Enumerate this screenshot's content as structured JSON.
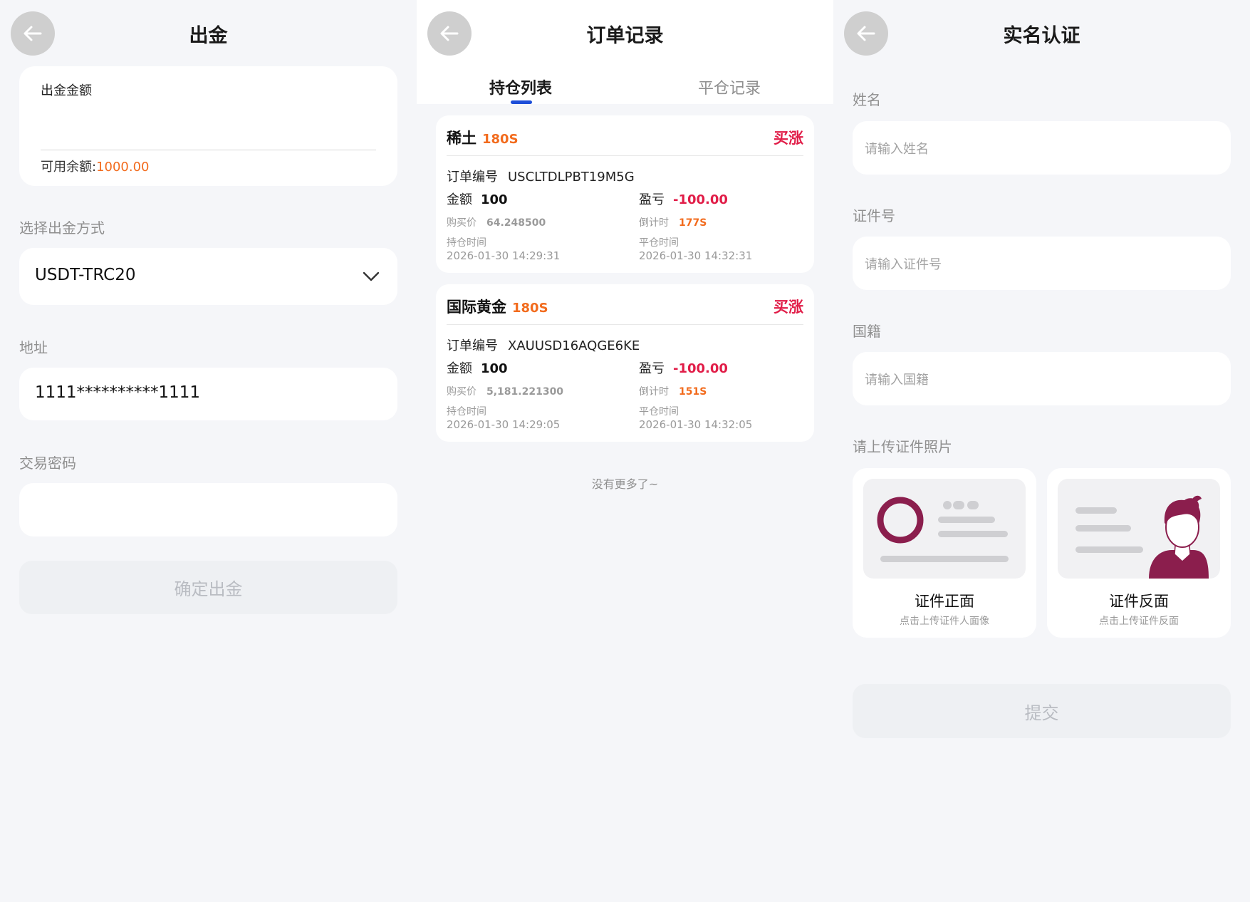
{
  "withdraw": {
    "title": "出金",
    "amount_label": "出金金额",
    "balance_label": "可用余额:",
    "balance_value": "1000.00",
    "method_label": "选择出金方式",
    "method_value": "USDT-TRC20",
    "address_label": "地址",
    "address_value": "1111**********1111",
    "password_label": "交易密码",
    "password_value": "",
    "confirm_label": "确定出金"
  },
  "orders": {
    "title": "订单记录",
    "tabs": [
      {
        "label": "持仓列表",
        "active": true
      },
      {
        "label": "平仓记录",
        "active": false
      }
    ],
    "items": [
      {
        "name": "稀土",
        "duration": "180S",
        "direction": "买涨",
        "order_no_label": "订单编号",
        "order_no": "USCLTDLPBT19M5G",
        "amount_label": "金额",
        "amount": "100",
        "pnl_label": "盈亏",
        "pnl": "-100.00",
        "buy_price_label": "购买价",
        "buy_price": "64.248500",
        "countdown_label": "倒计时",
        "countdown": "177S",
        "open_time_label": "持仓时间",
        "open_time": "2026-01-30 14:29:31",
        "close_time_label": "平仓时间",
        "close_time": "2026-01-30 14:32:31"
      },
      {
        "name": "国际黄金",
        "duration": "180S",
        "direction": "买涨",
        "order_no_label": "订单编号",
        "order_no": "XAUUSD16AQGE6KE",
        "amount_label": "金额",
        "amount": "100",
        "pnl_label": "盈亏",
        "pnl": "-100.00",
        "buy_price_label": "购买价",
        "buy_price": "5,181.221300",
        "countdown_label": "倒计时",
        "countdown": "151S",
        "open_time_label": "持仓时间",
        "open_time": "2026-01-30 14:29:05",
        "close_time_label": "平仓时间",
        "close_time": "2026-01-30 14:32:05"
      }
    ],
    "no_more": "没有更多了~"
  },
  "verify": {
    "title": "实名认证",
    "name_label": "姓名",
    "name_placeholder": "请输入姓名",
    "id_label": "证件号",
    "id_placeholder": "请输入证件号",
    "nationality_label": "国籍",
    "nationality_placeholder": "请输入国籍",
    "upload_label": "请上传证件照片",
    "front_title": "证件正面",
    "front_hint": "点击上传证件人面像",
    "back_title": "证件反面",
    "back_hint": "点击上传证件反面",
    "submit_label": "提交"
  },
  "colors": {
    "accent_orange": "#f26b1d",
    "loss_red": "#e11d48",
    "tab_indicator": "#1d4ed8",
    "id_illustration": "#8b1e4d"
  },
  "icons": [
    "back-arrow-icon",
    "chevron-down-icon",
    "id-card-front-icon",
    "id-card-portrait-icon"
  ]
}
